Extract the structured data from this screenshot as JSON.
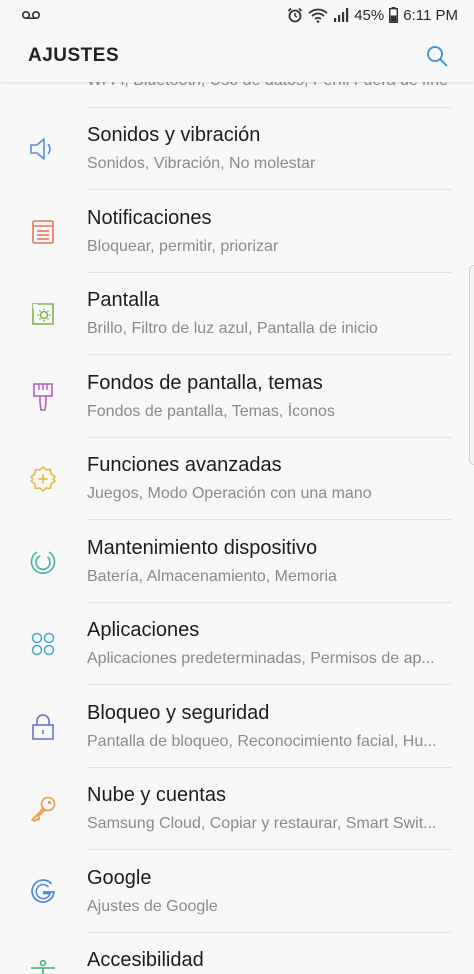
{
  "status_bar": {
    "battery": "45%",
    "time": "6:11 PM"
  },
  "app_bar": {
    "title": "AJUSTES"
  },
  "clipped_item": {
    "subtitle": "Wi-Fi, Bluetooth, Uso de datos, Perfil Fuera de línea"
  },
  "items": [
    {
      "title": "Sonidos y vibración",
      "subtitle": "Sonidos, Vibración, No molestar",
      "icon": "speaker-icon",
      "color": "#5b8ed8"
    },
    {
      "title": "Notificaciones",
      "subtitle": "Bloquear, permitir, priorizar",
      "icon": "notification-list-icon",
      "color": "#e8735e"
    },
    {
      "title": "Pantalla",
      "subtitle": "Brillo, Filtro de luz azul, Pantalla de inicio",
      "icon": "display-brightness-icon",
      "color": "#7db24a"
    },
    {
      "title": "Fondos de pantalla, temas",
      "subtitle": "Fondos de pantalla, Temas, Íconos",
      "icon": "paintbrush-icon",
      "color": "#b25fc2"
    },
    {
      "title": "Funciones avanzadas",
      "subtitle": "Juegos, Modo Operación con una mano",
      "icon": "gear-plus-icon",
      "color": "#e7b53a"
    },
    {
      "title": "Mantenimiento dispositivo",
      "subtitle": "Batería, Almacenamiento, Memoria",
      "icon": "device-care-icon",
      "color": "#3fb5a8"
    },
    {
      "title": "Aplicaciones",
      "subtitle": "Aplicaciones predeterminadas, Permisos de ap...",
      "icon": "apps-grid-icon",
      "color": "#4aa6c9"
    },
    {
      "title": "Bloqueo y seguridad",
      "subtitle": "Pantalla de bloqueo, Reconocimiento facial, Hu...",
      "icon": "lock-icon",
      "color": "#6c71d6"
    },
    {
      "title": "Nube y cuentas",
      "subtitle": "Samsung Cloud, Copiar y restaurar, Smart Swit...",
      "icon": "key-icon",
      "color": "#e89a4a"
    },
    {
      "title": "Google",
      "subtitle": "Ajustes de Google",
      "icon": "google-icon",
      "color": "#4f86d9"
    },
    {
      "title": "Accesibilidad",
      "subtitle": "",
      "icon": "accessibility-icon",
      "color": "#3fae7a"
    }
  ]
}
